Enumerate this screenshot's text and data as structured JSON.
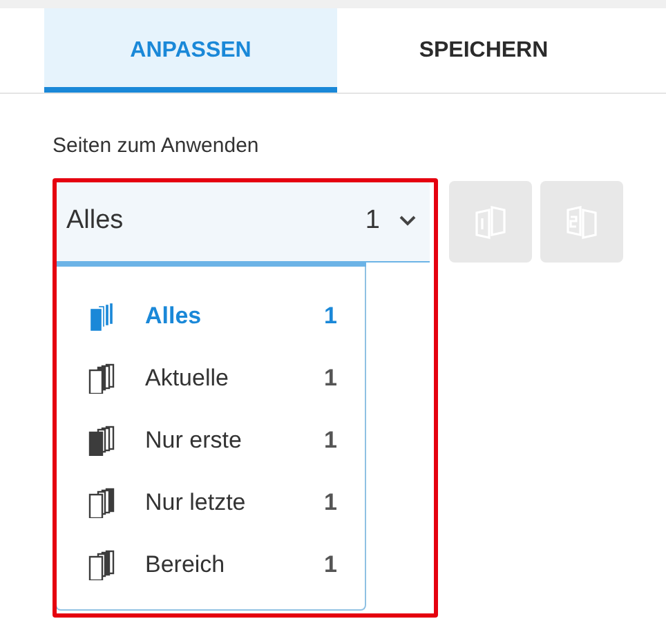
{
  "tabs": [
    {
      "label": "ANPASSEN",
      "selected": true
    },
    {
      "label": "SPEICHERN",
      "selected": false
    }
  ],
  "section_label": "Seiten zum Anwenden",
  "page_select": {
    "value": "Alles",
    "count": "1",
    "expanded": true,
    "options": [
      {
        "label": "Alles",
        "count": "1",
        "kind": "all",
        "selected": true
      },
      {
        "label": "Aktuelle",
        "count": "1",
        "kind": "current",
        "selected": false
      },
      {
        "label": "Nur erste",
        "count": "1",
        "kind": "first",
        "selected": false
      },
      {
        "label": "Nur letzte",
        "count": "1",
        "kind": "last",
        "selected": false
      },
      {
        "label": "Bereich",
        "count": "1",
        "kind": "range",
        "selected": false
      }
    ]
  },
  "order_buttons": [
    {
      "kind": "odd",
      "disabled": true
    },
    {
      "kind": "even",
      "disabled": true
    }
  ]
}
